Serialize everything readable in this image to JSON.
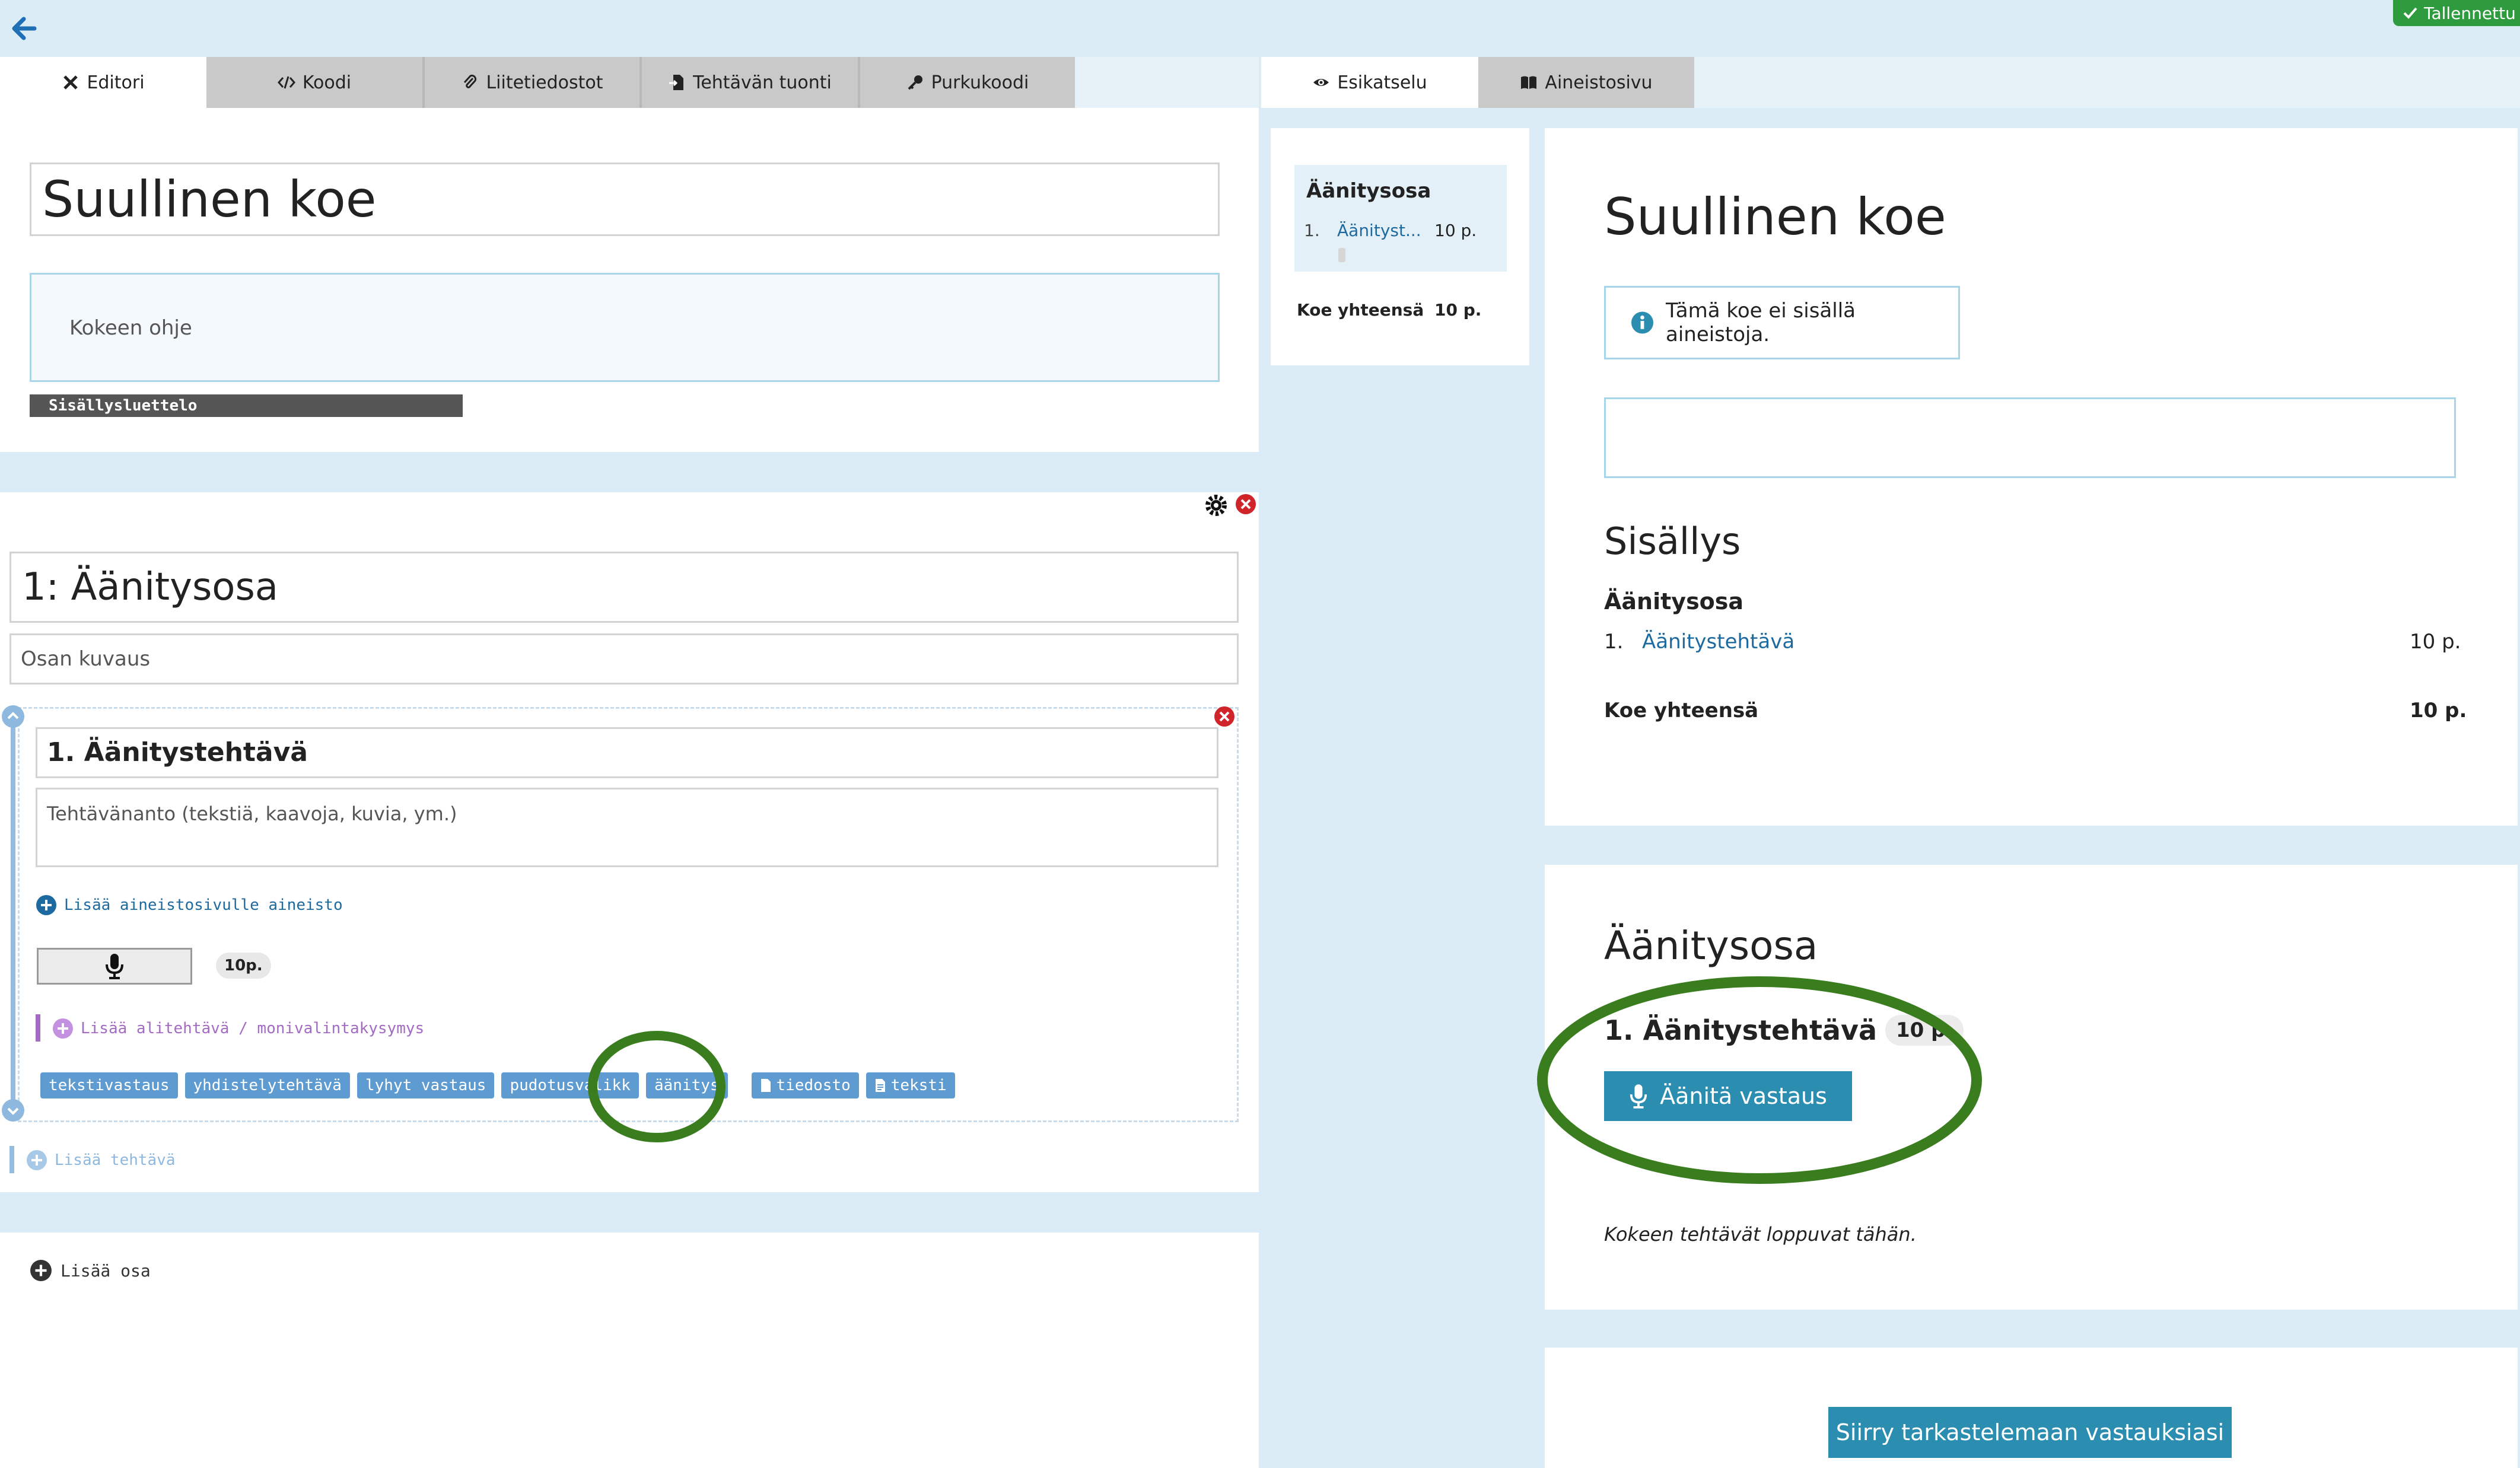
{
  "header": {
    "back_icon": "arrow-left-icon",
    "saved_label": "Tallennettu"
  },
  "editor_tabs": [
    {
      "label": "Editori",
      "icon": "tools-icon"
    },
    {
      "label": "Koodi",
      "icon": "code-icon"
    },
    {
      "label": "Liitetiedostot",
      "icon": "paperclip-icon"
    },
    {
      "label": "Tehtävän tuonti",
      "icon": "file-import-icon"
    },
    {
      "label": "Purkukoodi",
      "icon": "key-icon"
    }
  ],
  "preview_tabs": [
    {
      "label": "Esikatselu",
      "icon": "eye-icon"
    },
    {
      "label": "Aineistosivu",
      "icon": "book-icon"
    }
  ],
  "editor": {
    "exam_title": "Suullinen koe",
    "instructions_placeholder": "Kokeen ohje",
    "toc_button": "Sisällysluettelo",
    "section": {
      "title": "1: Äänitysosa",
      "description_placeholder": "Osan kuvaus",
      "task": {
        "title": "1. Äänitystehtävä",
        "prompt_placeholder": "Tehtävänanto (tekstiä, kaavoja, kuvia, ym.)",
        "add_material_link": "Lisää aineistosivulle aineisto",
        "points": "10p.",
        "add_subtask_link": "Lisää alitehtävä / monivalintakysymys",
        "answer_types": [
          "tekstivastaus",
          "yhdistelytehtävä",
          "lyhyt vastaus",
          "pudotusvalikk",
          "äänitys",
          "tiedosto",
          "teksti"
        ]
      },
      "add_task_link": "Lisää tehtävä"
    },
    "add_section_link": "Lisää osa"
  },
  "preview": {
    "sidebar": {
      "section": "Äänitysosa",
      "item_number": "1.",
      "item_label": "Äänityst...",
      "item_points": "10 p.",
      "total_label": "Koe yhteensä",
      "total_points": "10 p."
    },
    "exam_title": "Suullinen koe",
    "info_text": "Tämä koe ei sisällä aineistoja.",
    "contents_heading": "Sisällys",
    "contents_section": "Äänitysosa",
    "contents_item_number": "1.",
    "contents_item_label": "Äänitystehtävä",
    "contents_item_points": "10 p.",
    "contents_total_label": "Koe yhteensä",
    "contents_total_points": "10 p.",
    "section_heading": "Äänitysosa",
    "task_title": "1. Äänitystehtävä",
    "task_points": "10 p.",
    "record_button": "Äänitä vastaus",
    "end_text": "Kokeen tehtävät loppuvat tähän.",
    "review_button": "Siirry tarkastelemaan vastauksiasi"
  },
  "colors": {
    "background": "#dbecf7",
    "accent": "#2b8eb1",
    "saved_green": "#2e9b3e",
    "highlight_circle": "#3a7d1e",
    "chip_blue": "#5e9bd0",
    "subtask_purple": "#a46bc4"
  }
}
